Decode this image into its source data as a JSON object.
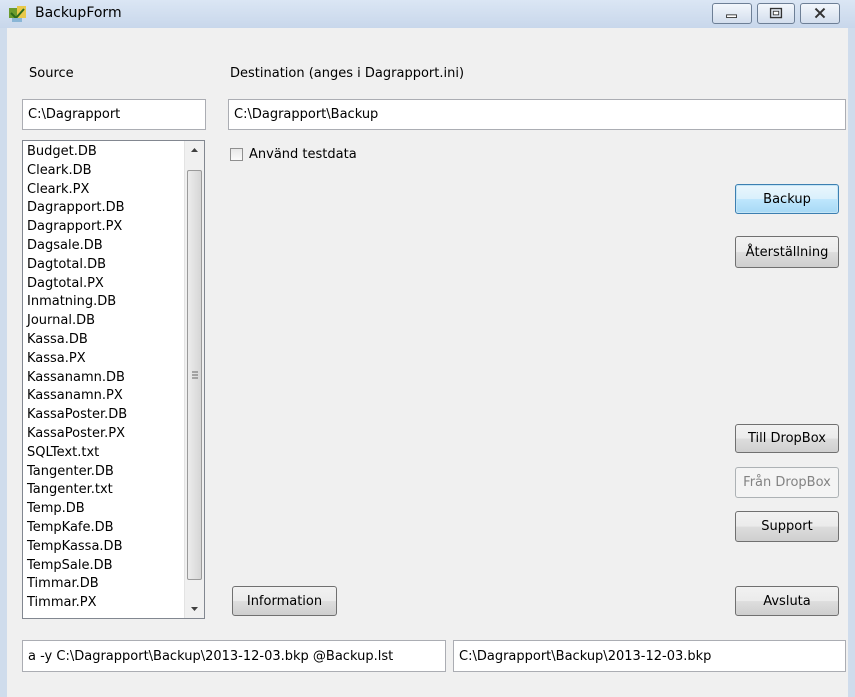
{
  "window": {
    "title": "BackupForm"
  },
  "labels": {
    "source": "Source",
    "destination": "Destination (anges i Dagrapport.ini)"
  },
  "inputs": {
    "source_path": "C:\\Dagrapport",
    "destination_path": "C:\\Dagrapport\\Backup",
    "command_line": "a -y C:\\Dagrapport\\Backup\\2013-12-03.bkp @Backup.lst",
    "backup_file": "C:\\Dagrapport\\Backup\\2013-12-03.bkp"
  },
  "file_list": [
    "Budget.DB",
    "Cleark.DB",
    "Cleark.PX",
    "Dagrapport.DB",
    "Dagrapport.PX",
    "Dagsale.DB",
    "Dagtotal.DB",
    "Dagtotal.PX",
    "Inmatning.DB",
    "Journal.DB",
    "Kassa.DB",
    "Kassa.PX",
    "Kassanamn.DB",
    "Kassanamn.PX",
    "KassaPoster.DB",
    "KassaPoster.PX",
    "SQLText.txt",
    "Tangenter.DB",
    "Tangenter.txt",
    "Temp.DB",
    "TempKafe.DB",
    "TempKassa.DB",
    "TempSale.DB",
    "Timmar.DB",
    "Timmar.PX"
  ],
  "checkbox": {
    "label": "Använd testdata",
    "checked": false
  },
  "buttons": {
    "backup": "Backup",
    "restore": "Återställning",
    "to_dropbox": "Till DropBox",
    "from_dropbox": "Från DropBox",
    "support": "Support",
    "information": "Information",
    "exit": "Avsluta"
  },
  "icons": {
    "app": "backup-app-icon",
    "minimize": "minimize-icon",
    "maximize": "maximize-icon",
    "close": "close-icon",
    "scroll_up": "chevron-up-icon",
    "scroll_down": "chevron-down-icon"
  },
  "colors": {
    "titlebar": "#cfdcec",
    "client": "#f0f0f0",
    "default_button_border": "#3c7fb1"
  }
}
